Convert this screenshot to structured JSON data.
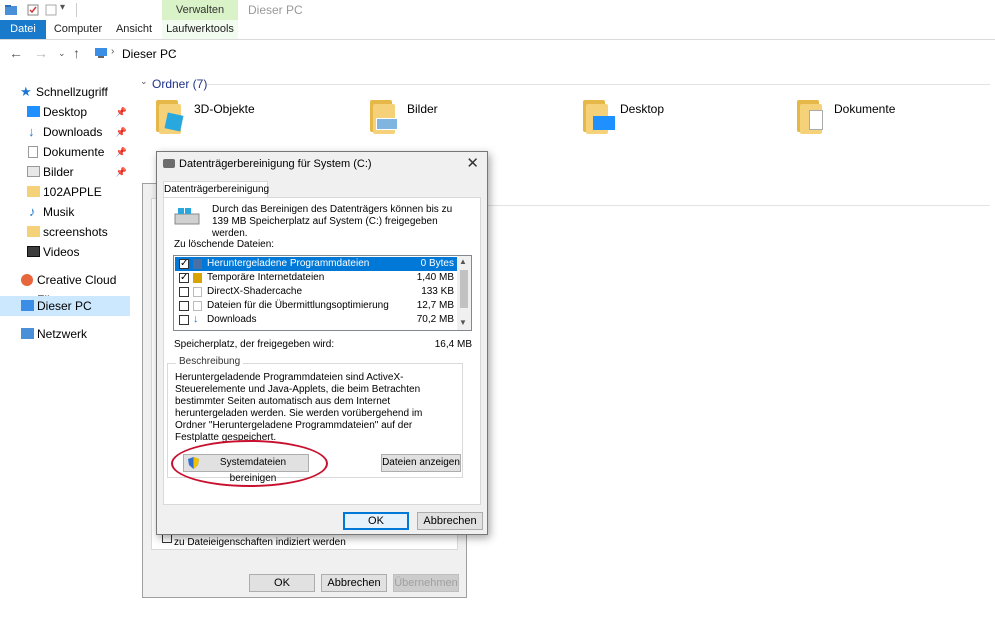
{
  "window": {
    "title": "Dieser PC",
    "context_group": "Verwalten"
  },
  "ribbon": {
    "tabs": [
      "Datei",
      "Computer",
      "Ansicht",
      "Laufwerktools"
    ]
  },
  "address": {
    "path": "Dieser PC"
  },
  "nav": {
    "quick_access": "Schnellzugriff",
    "items": [
      "Desktop",
      "Downloads",
      "Dokumente",
      "Bilder",
      "102APPLE",
      "Musik",
      "screenshots",
      "Videos"
    ],
    "creative_cloud": "Creative Cloud Files",
    "this_pc": "Dieser PC",
    "network": "Netzwerk"
  },
  "content": {
    "group_header": "Ordner (7)",
    "folders": [
      "3D-Objekte",
      "Bilder",
      "Desktop",
      "Dokumente"
    ]
  },
  "bg_dialog": {
    "index_text": "zu Dateieigenschaften indiziert werden",
    "ok": "OK",
    "cancel": "Abbrechen",
    "apply": "Übernehmen"
  },
  "cleanup_dialog": {
    "title": "Datenträgerbereinigung für System (C:)",
    "tab": "Datenträgerbereinigung",
    "intro": "Durch das Bereinigen des Datenträgers können bis zu 139 MB Speicherplatz auf System (C:) freigegeben werden.",
    "list_label": "Zu löschende Dateien:",
    "files": [
      {
        "name": "Heruntergeladene Programmdateien",
        "size": "0 Bytes",
        "checked": true,
        "selected": true
      },
      {
        "name": "Temporäre Internetdateien",
        "size": "1,40 MB",
        "checked": true,
        "selected": false
      },
      {
        "name": "DirectX-Shadercache",
        "size": "133 KB",
        "checked": false,
        "selected": false
      },
      {
        "name": "Dateien für die Übermittlungsoptimierung",
        "size": "12,7 MB",
        "checked": false,
        "selected": false
      },
      {
        "name": "Downloads",
        "size": "70,2 MB",
        "checked": false,
        "selected": false
      }
    ],
    "space_label": "Speicherplatz, der freigegeben wird:",
    "space_value": "16,4 MB",
    "desc_legend": "Beschreibung",
    "desc_text": "Heruntergeladende Programmdateien sind ActiveX-Steuerelemente und Java-Applets, die beim Betrachten bestimmter Seiten automatisch aus dem Internet heruntergeladen werden. Sie werden vorübergehend im Ordner \"Heruntergeladene Programmdateien\" auf der Festplatte gespeichert.",
    "clean_system_btn": "Systemdateien bereinigen",
    "show_files_btn": "Dateien anzeigen",
    "ok": "OK",
    "cancel": "Abbrechen"
  },
  "colors": {
    "accent": "#0078d7",
    "file_tab": "#1979ca",
    "context_tab": "#d9f2c7",
    "highlight_ellipse": "#c8102e"
  }
}
